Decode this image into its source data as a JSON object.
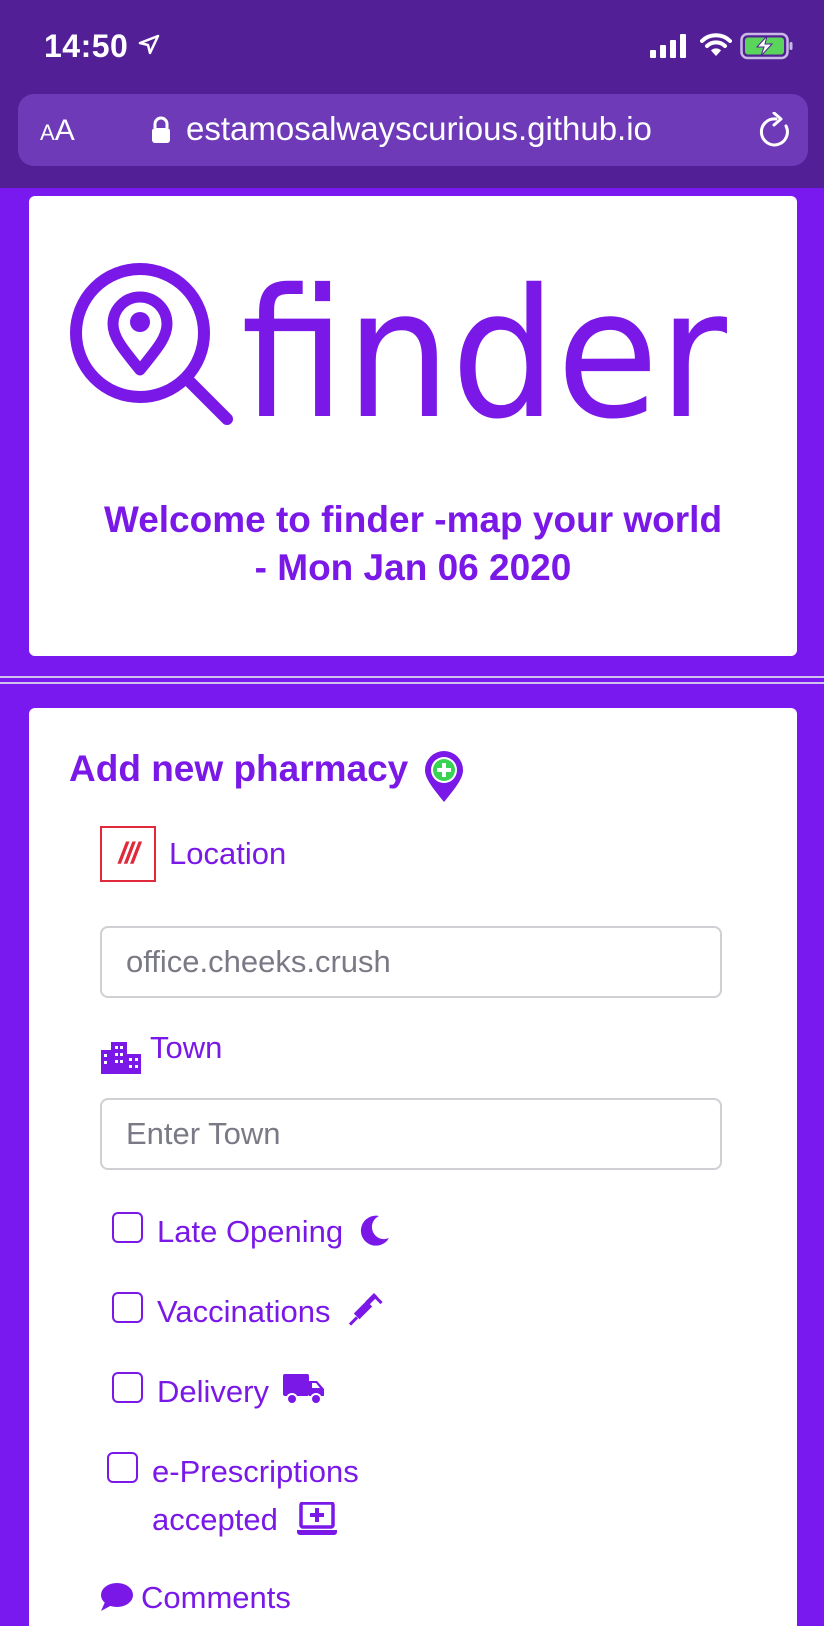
{
  "status_bar": {
    "time": "14:50"
  },
  "browser": {
    "text_size_label_small": "A",
    "text_size_label_large": "A",
    "url": "estamosalwayscurious.github.io"
  },
  "header": {
    "logo_text": "finder",
    "welcome_line1": "Welcome to finder -map your world",
    "welcome_line2": "- Mon Jan 06 2020"
  },
  "form": {
    "title": "Add new pharmacy",
    "location": {
      "badge": "///",
      "label": "Location",
      "value": "office.cheeks.crush"
    },
    "town": {
      "label": "Town",
      "placeholder": "Enter Town",
      "value": ""
    },
    "options": [
      {
        "label": "Late Opening",
        "icon": "moon-icon",
        "checked": false
      },
      {
        "label": "Vaccinations",
        "icon": "syringe-icon",
        "checked": false
      },
      {
        "label": "Delivery",
        "icon": "truck-icon",
        "checked": false
      },
      {
        "label_line1": "e-Prescriptions",
        "label_line2": "accepted",
        "icon": "medical-laptop-icon",
        "checked": false
      }
    ],
    "comments_label": "Comments"
  },
  "colors": {
    "brand_purple": "#7a18e8",
    "page_background": "#7a18f0",
    "status_bar_background": "#521f96",
    "what3words_red": "#e0293a",
    "plus_green": "#39d353"
  }
}
